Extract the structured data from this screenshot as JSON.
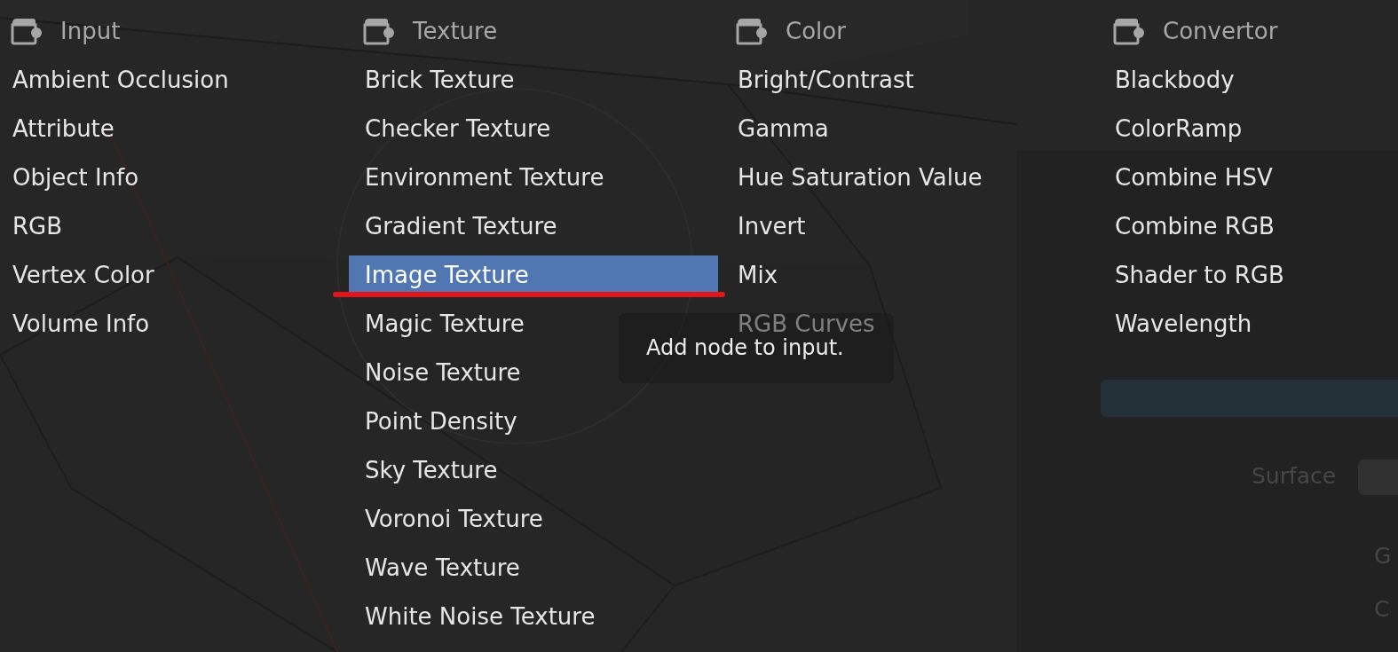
{
  "menu": {
    "columns": [
      {
        "title": "Input",
        "items": [
          {
            "label": "Ambient Occlusion",
            "selected": false,
            "marked": false
          },
          {
            "label": "Attribute",
            "selected": false,
            "marked": false
          },
          {
            "label": "Object Info",
            "selected": false,
            "marked": false
          },
          {
            "label": "RGB",
            "selected": false,
            "marked": false
          },
          {
            "label": "Vertex Color",
            "selected": false,
            "marked": false
          },
          {
            "label": "Volume Info",
            "selected": false,
            "marked": false
          }
        ]
      },
      {
        "title": "Texture",
        "items": [
          {
            "label": "Brick Texture",
            "selected": false,
            "marked": false
          },
          {
            "label": "Checker Texture",
            "selected": false,
            "marked": false
          },
          {
            "label": "Environment Texture",
            "selected": false,
            "marked": false
          },
          {
            "label": "Gradient Texture",
            "selected": false,
            "marked": false
          },
          {
            "label": "Image Texture",
            "selected": true,
            "marked": true
          },
          {
            "label": "Magic Texture",
            "selected": false,
            "marked": false
          },
          {
            "label": "Noise Texture",
            "selected": false,
            "marked": false
          },
          {
            "label": "Point Density",
            "selected": false,
            "marked": false
          },
          {
            "label": "Sky Texture",
            "selected": false,
            "marked": false
          },
          {
            "label": "Voronoi Texture",
            "selected": false,
            "marked": false
          },
          {
            "label": "Wave Texture",
            "selected": false,
            "marked": false
          },
          {
            "label": "White Noise Texture",
            "selected": false,
            "marked": false
          }
        ]
      },
      {
        "title": "Color",
        "items": [
          {
            "label": "Bright/Contrast",
            "selected": false,
            "marked": false
          },
          {
            "label": "Gamma",
            "selected": false,
            "marked": false
          },
          {
            "label": "Hue Saturation Value",
            "selected": false,
            "marked": false
          },
          {
            "label": "Invert",
            "selected": false,
            "marked": false
          },
          {
            "label": "Mix",
            "selected": false,
            "marked": false
          },
          {
            "label": "RGB Curves",
            "selected": false,
            "marked": false
          }
        ]
      },
      {
        "title": "Convertor",
        "items": [
          {
            "label": "Blackbody",
            "selected": false,
            "marked": false
          },
          {
            "label": "ColorRamp",
            "selected": false,
            "marked": false
          },
          {
            "label": "Combine HSV",
            "selected": false,
            "marked": false
          },
          {
            "label": "Combine RGB",
            "selected": false,
            "marked": false
          },
          {
            "label": "Shader to RGB",
            "selected": false,
            "marked": false
          },
          {
            "label": "Wavelength",
            "selected": false,
            "marked": false
          }
        ]
      }
    ]
  },
  "tooltip": {
    "text": "Add node to input."
  },
  "properties_panel": {
    "surface_label": "Surface",
    "field_1": "G",
    "field_2": "C"
  }
}
